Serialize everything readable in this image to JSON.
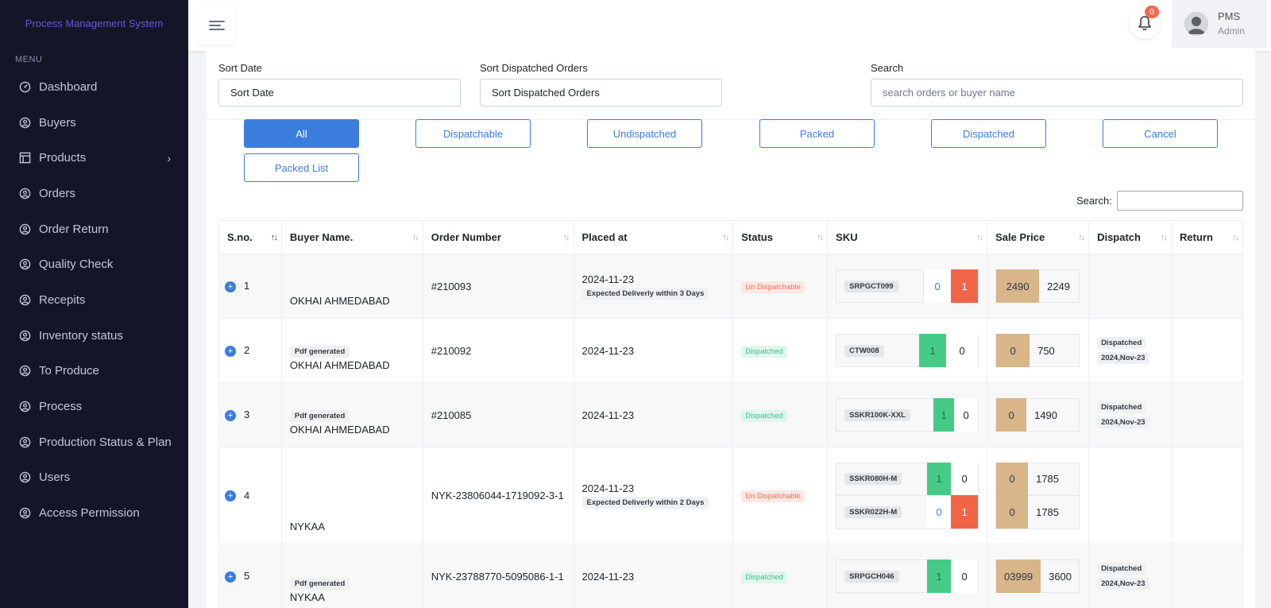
{
  "sidebar": {
    "brand": "Process Management System",
    "menu_title": "MENU",
    "items": [
      {
        "label": "Dashboard",
        "icon": "dashboard-icon"
      },
      {
        "label": "Buyers",
        "icon": "user-circle-icon"
      },
      {
        "label": "Products",
        "icon": "layout-icon",
        "has_children": true
      },
      {
        "label": "Orders",
        "icon": "user-circle-icon"
      },
      {
        "label": "Order Return",
        "icon": "user-circle-icon"
      },
      {
        "label": "Quality Check",
        "icon": "user-circle-icon"
      },
      {
        "label": "Recepits",
        "icon": "user-circle-icon"
      },
      {
        "label": "Inventory status",
        "icon": "user-circle-icon"
      },
      {
        "label": "To Produce",
        "icon": "user-circle-icon"
      },
      {
        "label": "Process",
        "icon": "user-circle-icon"
      },
      {
        "label": "Production Status & Plan",
        "icon": "user-circle-icon"
      },
      {
        "label": "Users",
        "icon": "user-circle-icon"
      },
      {
        "label": "Access Permission",
        "icon": "user-circle-icon"
      }
    ]
  },
  "topbar": {
    "notification_count": "0",
    "user_name": "PMS",
    "user_role": "Admin"
  },
  "filters": {
    "sort_date_label": "Sort Date",
    "sort_date_value": "Sort Date",
    "sort_dispatched_label": "Sort Dispatched Orders",
    "sort_dispatched_value": "Sort Dispatched Orders",
    "search_label": "Search",
    "search_placeholder": "search orders or buyer name"
  },
  "filter_buttons": [
    "All",
    "Dispatchable",
    "Undispatched",
    "Packed",
    "Dispatched",
    "Cancel",
    "Packed List"
  ],
  "table": {
    "search_label": "Search:",
    "headers": [
      "S.no.",
      "Buyer Name.",
      "Order Number",
      "Placed at",
      "Status",
      "SKU",
      "Sale Price",
      "Dispatch",
      "Return"
    ],
    "rows": [
      {
        "sno": "1",
        "pdf": "",
        "buyer": "OKHAI AHMEDABAD",
        "order": "#210093",
        "placed": "2024-11-23",
        "expected": "Expected Deliverly within 3 Days",
        "status": "Un Dispatchable",
        "skus": [
          {
            "code": "SRPGCT099",
            "a": "0",
            "b": "1",
            "price_a": "2490",
            "price_b": "2249"
          }
        ],
        "dispatch": "",
        "dispatch_date": ""
      },
      {
        "sno": "2",
        "pdf": "Pdf generated",
        "buyer": "OKHAI AHMEDABAD",
        "order": "#210092",
        "placed": "2024-11-23",
        "expected": "",
        "status": "Dispatched",
        "skus": [
          {
            "code": "CTW008",
            "a": "1",
            "b": "0",
            "price_a": "0",
            "price_b": "750"
          }
        ],
        "dispatch": "Dispatched",
        "dispatch_date": "2024,Nov-23"
      },
      {
        "sno": "3",
        "pdf": "Pdf generated",
        "buyer": "OKHAI AHMEDABAD",
        "order": "#210085",
        "placed": "2024-11-23",
        "expected": "",
        "status": "Dispatched",
        "skus": [
          {
            "code": "SSKR100K-XXL",
            "a": "1",
            "b": "0",
            "price_a": "0",
            "price_b": "1490"
          }
        ],
        "dispatch": "Dispatched",
        "dispatch_date": "2024,Nov-23"
      },
      {
        "sno": "4",
        "pdf": "",
        "buyer": "NYKAA",
        "order": "NYK-23806044-1719092-3-1",
        "placed": "2024-11-23",
        "expected": "Expected Deliverly within 2 Days",
        "status": "Un Dispatchable",
        "skus": [
          {
            "code": "SSKR080H-M",
            "a": "1",
            "b": "0",
            "price_a": "0",
            "price_b": "1785"
          },
          {
            "code": "SSKR022H-M",
            "a": "0",
            "b": "1",
            "price_a": "0",
            "price_b": "1785"
          }
        ],
        "dispatch": "",
        "dispatch_date": ""
      },
      {
        "sno": "5",
        "pdf": "Pdf generated",
        "buyer": "NYKAA",
        "order": "NYK-23788770-5095086-1-1",
        "placed": "2024-11-23",
        "expected": "",
        "status": "Dispatched",
        "skus": [
          {
            "code": "SRPGCH046",
            "a": "1",
            "b": "0",
            "price_a": "03999",
            "price_b": "3600"
          }
        ],
        "dispatch": "Dispatched",
        "dispatch_date": "2024,Nov-23"
      }
    ]
  },
  "colors": {
    "sidebar_bg": "#141628",
    "primary": "#3b7ddd",
    "danger": "#f06548",
    "success": "#45cb85",
    "price_tan": "#d9b58a"
  }
}
